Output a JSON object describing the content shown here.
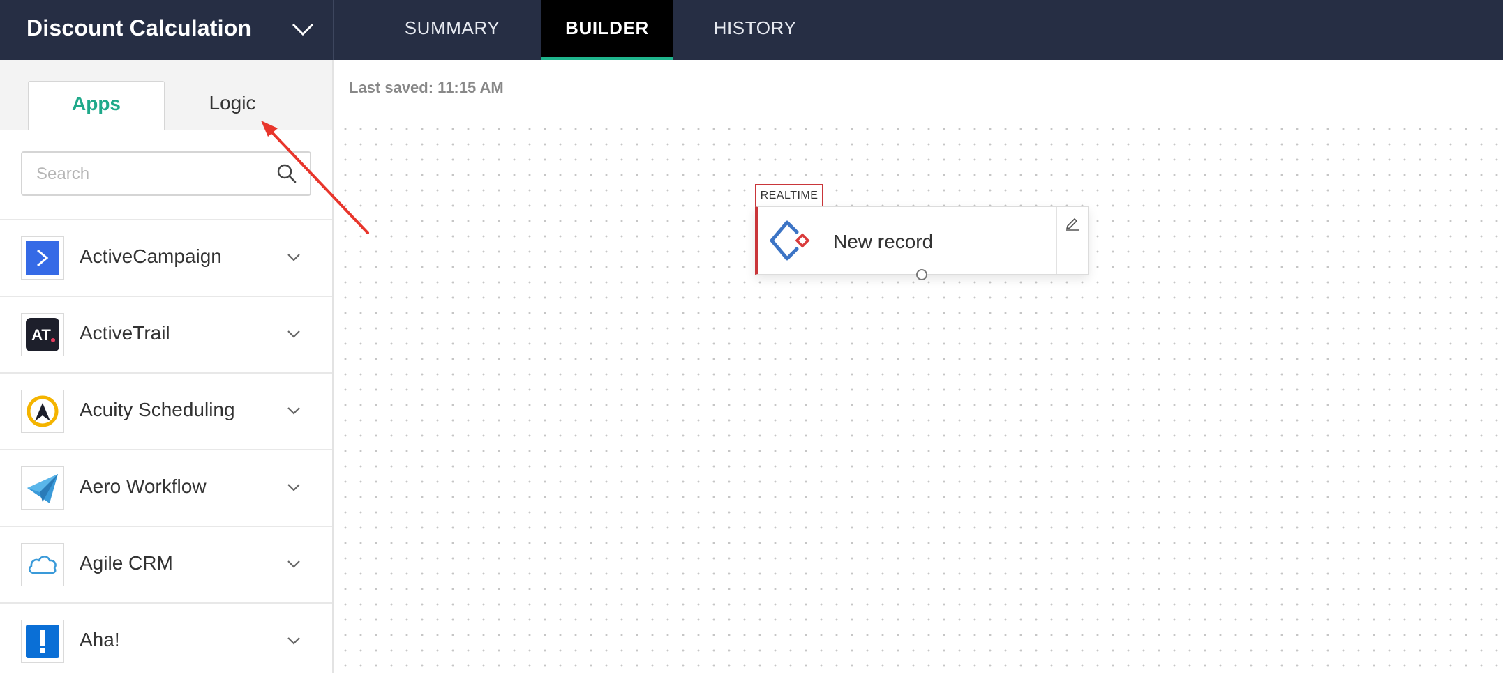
{
  "header": {
    "flow_title": "Discount Calculation",
    "tabs": [
      {
        "label": "SUMMARY",
        "active": false
      },
      {
        "label": "BUILDER",
        "active": true
      },
      {
        "label": "HISTORY",
        "active": false
      }
    ],
    "accent_color": "#1fb58d",
    "background_color": "#262e44"
  },
  "sidebar": {
    "tabs": [
      {
        "label": "Apps",
        "active": true
      },
      {
        "label": "Logic",
        "active": false
      }
    ],
    "search": {
      "placeholder": "Search",
      "value": "",
      "icon": "search-icon"
    },
    "apps": [
      {
        "name": "ActiveCampaign",
        "icon": "activecampaign-logo"
      },
      {
        "name": "ActiveTrail",
        "icon": "activetrail-logo"
      },
      {
        "name": "Acuity Scheduling",
        "icon": "acuity-scheduling-logo"
      },
      {
        "name": "Aero Workflow",
        "icon": "aero-workflow-logo"
      },
      {
        "name": "Agile CRM",
        "icon": "agile-crm-logo"
      },
      {
        "name": "Aha!",
        "icon": "aha-logo"
      }
    ]
  },
  "canvas": {
    "last_saved": "Last saved: 11:15 AM",
    "trigger_node": {
      "badge": "REALTIME",
      "label": "New record",
      "icon": "zoho-creator-logo",
      "edit_icon": "pencil-icon",
      "accent_color": "#c9363a"
    }
  },
  "annotation": {
    "type": "arrow",
    "points_to": "Logic tab",
    "color": "#e8352b"
  }
}
